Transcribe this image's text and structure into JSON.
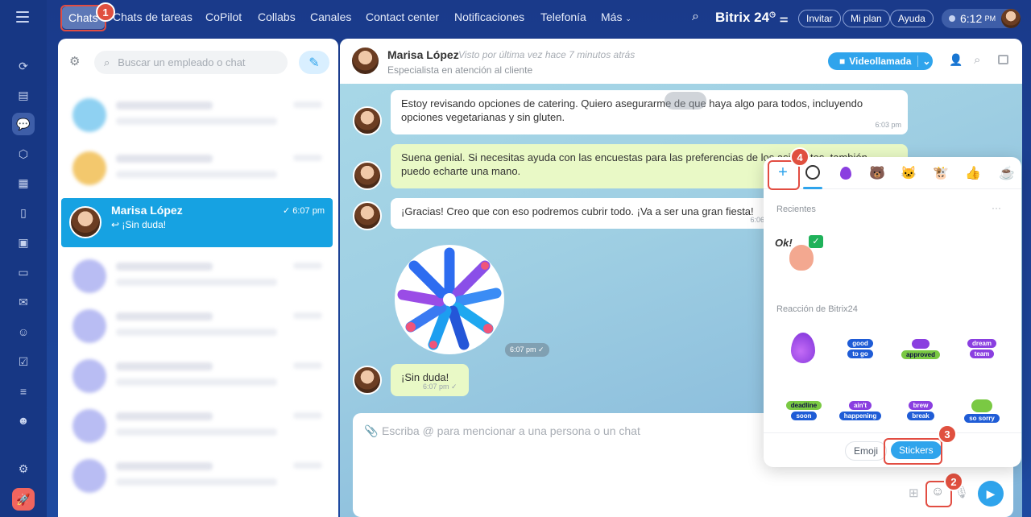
{
  "nav": {
    "items": [
      "Chats",
      "Chats de tareas",
      "CoPilot",
      "Collabs",
      "Canales",
      "Contact center",
      "Notificaciones",
      "Telefonía",
      "Más"
    ],
    "brand": "Bitrix 24",
    "invite": "Invitar",
    "plan": "Mi plan",
    "help": "Ayuda",
    "time": "6:12",
    "time_suffix": "PM"
  },
  "sidebar": {
    "search_placeholder": "Buscar un empleado o chat",
    "active_chat": {
      "name": "Marisa López",
      "time": "6:07 pm",
      "preview": "¡Sin duda!"
    }
  },
  "chat": {
    "name": "Marisa López",
    "last_seen": "Visto por última vez hace 7 minutos atrás",
    "role": "Especialista en atención al cliente",
    "video_button": "Videollamada",
    "messages": [
      {
        "text": "Estoy revisando opciones de catering. Quiero asegurarme de que haya algo para todos, incluyendo opciones vegetarianas y sin gluten.",
        "time": "6:03 pm"
      },
      {
        "text": "Suena genial. Si necesitas ayuda con las encuestas para las preferencias de los asistentes, también puedo echarte una mano.",
        "time": ""
      },
      {
        "text": "¡Gracias! Creo que con eso podremos cubrir todo. ¡Va a ser una gran fiesta!",
        "time": "6:06"
      },
      {
        "text": "",
        "time": "6:07 pm"
      },
      {
        "text": "¡Sin duda!",
        "time": "6:07 pm"
      }
    ],
    "input_placeholder": "Escriba @ para mencionar a una persona o un chat"
  },
  "panel": {
    "recent_label": "Recientes",
    "bitrix_label": "Reacción de Bitrix24",
    "ok_text": "Ok!",
    "stickers": [
      [
        "good",
        "to go"
      ],
      [
        "approved"
      ],
      [
        "dream",
        "team"
      ],
      [
        "deadline",
        "soon"
      ],
      [
        "ain't",
        "happening"
      ],
      [
        "brew",
        "break"
      ],
      [
        "so sorry"
      ]
    ],
    "tab_emoji": "Emoji",
    "tab_stickers": "Stickers"
  },
  "badges": [
    "1",
    "2",
    "3",
    "4"
  ],
  "colors": {
    "accent": "#2fa4ec",
    "highlight": "#e24d42",
    "active_chat": "#16a2e2"
  }
}
